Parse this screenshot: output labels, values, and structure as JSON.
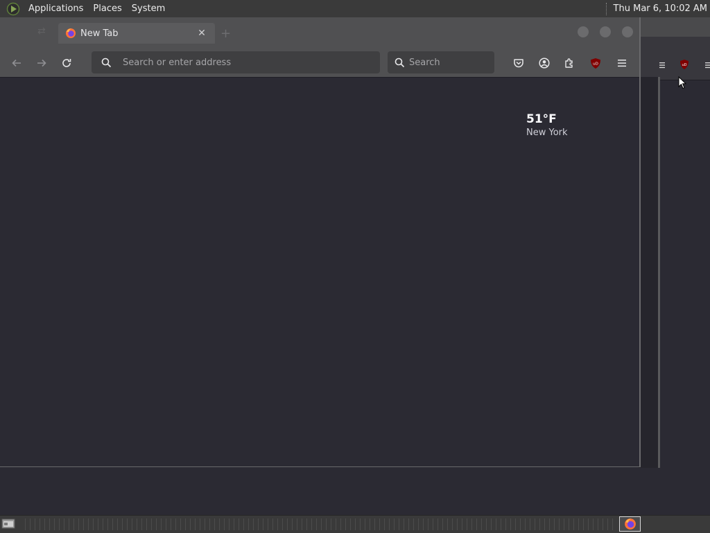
{
  "top_panel": {
    "menus": [
      "Applications",
      "Places",
      "System"
    ],
    "clock": "Thu Mar  6, 10:02 AM"
  },
  "browser": {
    "tab": {
      "title": "New Tab"
    },
    "url_bar": {
      "placeholder": "Search or enter address"
    },
    "search_bar": {
      "placeholder": "Search"
    },
    "toolbar_icons": [
      "pocket-icon",
      "account-icon",
      "extensions-icon",
      "ublock-origin-icon",
      "menu-icon"
    ]
  },
  "new_tab_page": {
    "weather": {
      "temperature": "51°F",
      "location": "New York"
    }
  },
  "colors": {
    "content_bg": "#2b2a33",
    "chrome_bg": "#505052",
    "ublock_red": "#800000"
  }
}
